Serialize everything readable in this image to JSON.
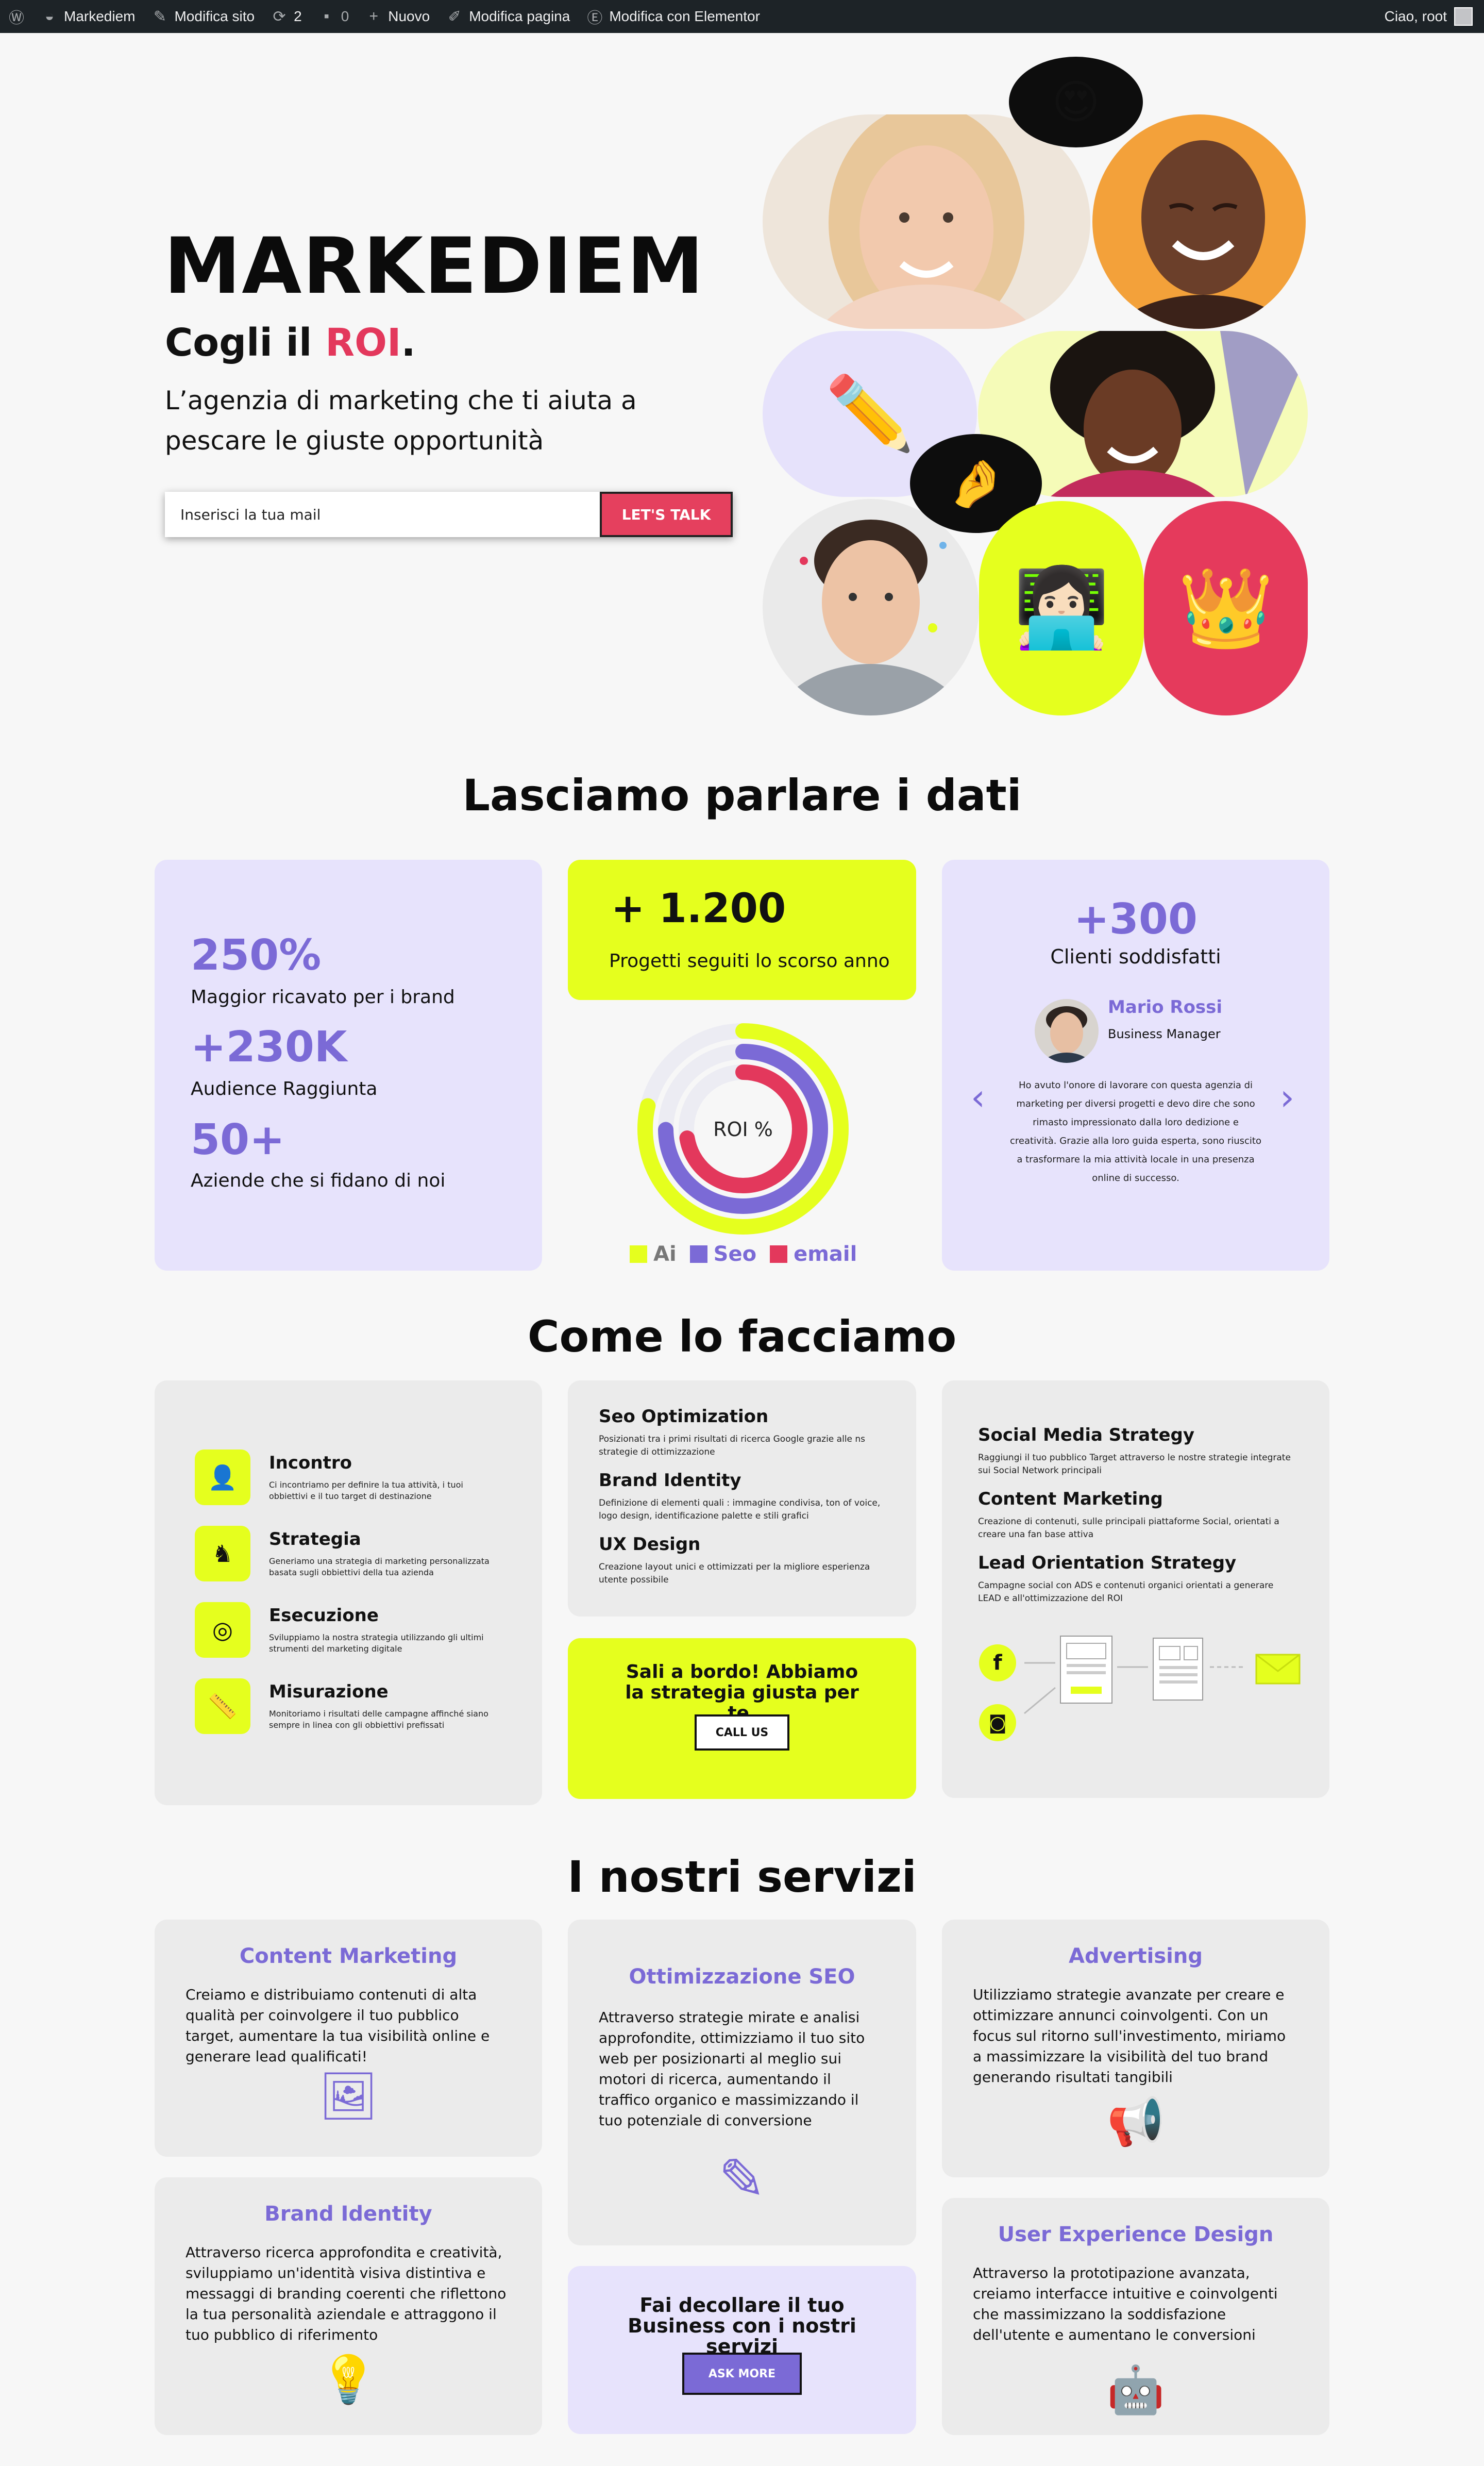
{
  "admin_bar": {
    "site": "Markediem",
    "edit_site": "Modifica sito",
    "updates": "2",
    "comments": "0",
    "new": "Nuovo",
    "edit_page": "Modifica pagina",
    "edit_elementor": "Modifica con Elementor",
    "greeting": "Ciao, root"
  },
  "hero": {
    "title": "MARKEDIEM",
    "subtitle_prefix": "Cogli il ",
    "subtitle_highlight": "ROI",
    "subtitle_suffix": ".",
    "description": "L’agenzia di marketing che ti aiuta a pescare le giuste opportunità",
    "email_placeholder": "Inserisci la tua mail",
    "cta": "LET'S TALK",
    "emojis": {
      "bubble_top": "😍",
      "pencil": "✏️",
      "bubble_mid": "🤌",
      "laptop": "👩🏻‍💻",
      "crown": "👑"
    }
  },
  "data_section": {
    "title": "Lasciamo parlare i dati",
    "stats": [
      {
        "value": "250%",
        "label": "Maggior ricavato per i brand"
      },
      {
        "value": "+230K",
        "label": "Audience Raggiunta"
      },
      {
        "value": "50+",
        "label": "Aziende che si fidano di noi"
      }
    ],
    "projects": {
      "value": "+ 1.200",
      "label": "Progetti seguiti lo scorso anno"
    },
    "roi_chart": {
      "center_label": "ROI %",
      "legend": [
        "Ai",
        "Seo",
        "email"
      ],
      "colors": {
        "Ai": "#e5ff1e",
        "Seo": "#7b6ad6",
        "email": "#e3385c",
        "track": "#ececf3"
      }
    },
    "clients": {
      "value": "+300",
      "label": "Clienti soddisfatti"
    },
    "testimonial": {
      "name": "Mario Rossi",
      "role": "Business Manager",
      "text": "Ho avuto l'onore di lavorare con questa agenzia di marketing per diversi progetti e devo dire che sono rimasto impressionato dalla loro dedizione e creatività. Grazie alla loro guida esperta, sono riuscito a trasformare la mia attività locale in una presenza online di successo.",
      "prev": "‹",
      "next": "›"
    }
  },
  "how_section": {
    "title": "Come lo facciamo",
    "steps": [
      {
        "title": "Incontro",
        "text": "Ci incontriamo per definire la tua attività, i tuoi obbiettivi e il tuo target di destinazione",
        "icon": "meeting-icon",
        "glyph": "👤"
      },
      {
        "title": "Strategia",
        "text": "Generiamo una strategia di marketing personalizzata basata sugli obbiettivi della tua azienda",
        "icon": "strategy-icon",
        "glyph": "♞"
      },
      {
        "title": "Esecuzione",
        "text": "Sviluppiamo la nostra strategia utilizzando gli ultimi strumenti del marketing digitale",
        "icon": "target-icon",
        "glyph": "◎"
      },
      {
        "title": "Misurazione",
        "text": "Monitoriamo i risultati delle campagne affinché siano sempre in linea con gli obbiettivi prefissati",
        "icon": "ruler-icon",
        "glyph": "📏"
      }
    ],
    "middle_blocks": [
      {
        "title": "Seo Optimization",
        "text": "Posizionati tra i primi risultati di ricerca Google grazie alle ns strategie di ottimizzazione"
      },
      {
        "title": "Brand Identity",
        "text": "Definizione di elementi quali : immagine condivisa, ton of voice, logo design, identificazione palette e stili grafici"
      },
      {
        "title": "UX Design",
        "text": "Creazione layout unici e ottimizzati per la migliore esperienza utente possibile"
      }
    ],
    "cta": {
      "text": "Sali a bordo! Abbiamo la strategia giusta per te.",
      "button": "CALL US"
    },
    "right_blocks": [
      {
        "title": "Social Media Strategy",
        "text": "Raggiungi il tuo pubblico Target attraverso le nostre strategie integrate sui Social Network principali"
      },
      {
        "title": "Content Marketing",
        "text": "Creazione di contenuti, sulle principali piattaforme Social, orientati a creare una fan base attiva"
      },
      {
        "title": "Lead Orientation Strategy",
        "text": "Campagne social con ADS e contenuti organici orientati a generare LEAD e all'ottimizzazione del ROI"
      }
    ],
    "diagram_icons": {
      "facebook": "f",
      "instagram": "◙",
      "mail": "✉"
    }
  },
  "services_section": {
    "title": "I nostri servizi",
    "services": [
      {
        "title": "Content Marketing",
        "text": "Creiamo e distribuiamo contenuti di alta qualità per coinvolgere il tuo pubblico target, aumentare la tua visibilità online e generare lead qualificati!",
        "icon": "image-icon",
        "glyph": "🖼"
      },
      {
        "title": "Ottimizzazione SEO",
        "text": "Attraverso strategie mirate e analisi approfondite, ottimizziamo il tuo sito web per posizionarti al meglio sui motori di ricerca, aumentando il traffico organico e massimizzando il tuo potenziale di conversione",
        "icon": "pen-icon",
        "glyph": "✎"
      },
      {
        "title": "Advertising",
        "text": "Utilizziamo strategie avanzate per creare e ottimizzare annunci coinvolgenti. Con un focus sul ritorno sull'investimento, miriamo a massimizzare la visibilità del tuo brand generando risultati tangibili",
        "icon": "megaphone-icon",
        "glyph": "📢"
      },
      {
        "title": "Brand Identity",
        "text": "Attraverso ricerca approfondita e creatività, sviluppiamo un'identità visiva distintiva e messaggi di branding coerenti che riflettono la tua personalità aziendale e attraggono il tuo pubblico di riferimento",
        "icon": "lightbulb-icon",
        "glyph": "💡"
      },
      {
        "title": "User Experience Design",
        "text": "Attraverso la prototipazione avanzata, creiamo interfacce intuitive e coinvolgenti che massimizzano la soddisfazione dell'utente e aumentano le conversioni",
        "icon": "robot-icon",
        "glyph": "🤖"
      }
    ],
    "cta": {
      "text": "Fai decollare il tuo Business con i nostri servizi",
      "button": "ASK MORE"
    }
  }
}
